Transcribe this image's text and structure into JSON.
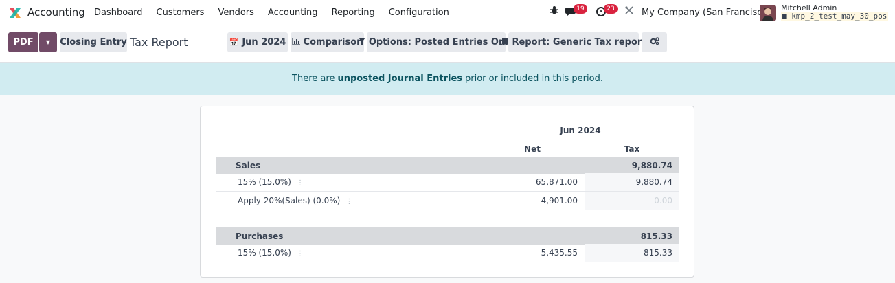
{
  "navbar": {
    "app_name": "Accounting",
    "menu": [
      "Dashboard",
      "Customers",
      "Vendors",
      "Accounting",
      "Reporting",
      "Configuration"
    ],
    "messages_count": "19",
    "activities_count": "23",
    "company": "My Company (San Francisco)",
    "user_name": "Mitchell Admin",
    "db_name": "kmp_2_test_may_30_pos"
  },
  "control_panel": {
    "pdf_label": "PDF",
    "closing_entry_label": "Closing Entry",
    "title": "Tax Report",
    "date_filter": "Jun 2024",
    "comparison": "Comparison",
    "options": "Options: Posted Entries Only",
    "report": "Report: Generic Tax report"
  },
  "alert": {
    "before": "There are",
    "bold": "unposted Journal Entries",
    "after": "prior or included in this period."
  },
  "report": {
    "period": "Jun 2024",
    "columns": [
      "Net",
      "Tax"
    ],
    "sections": [
      {
        "name": "Sales",
        "tax": "9,880.74",
        "lines": [
          {
            "label": "15% (15.0%)",
            "net": "65,871.00",
            "tax": "9,880.74"
          },
          {
            "label": "Apply 20%(Sales) (0.0%)",
            "net": "4,901.00",
            "tax": "0.00"
          }
        ]
      },
      {
        "name": "Purchases",
        "tax": "815.33",
        "lines": [
          {
            "label": "15% (15.0%)",
            "net": "5,435.55",
            "tax": "815.33"
          }
        ]
      }
    ]
  },
  "colors": {
    "brand": "#714b67",
    "alert_bg": "#d1ecf1",
    "alert_text": "#0c5460",
    "badge": "#d9233f"
  }
}
